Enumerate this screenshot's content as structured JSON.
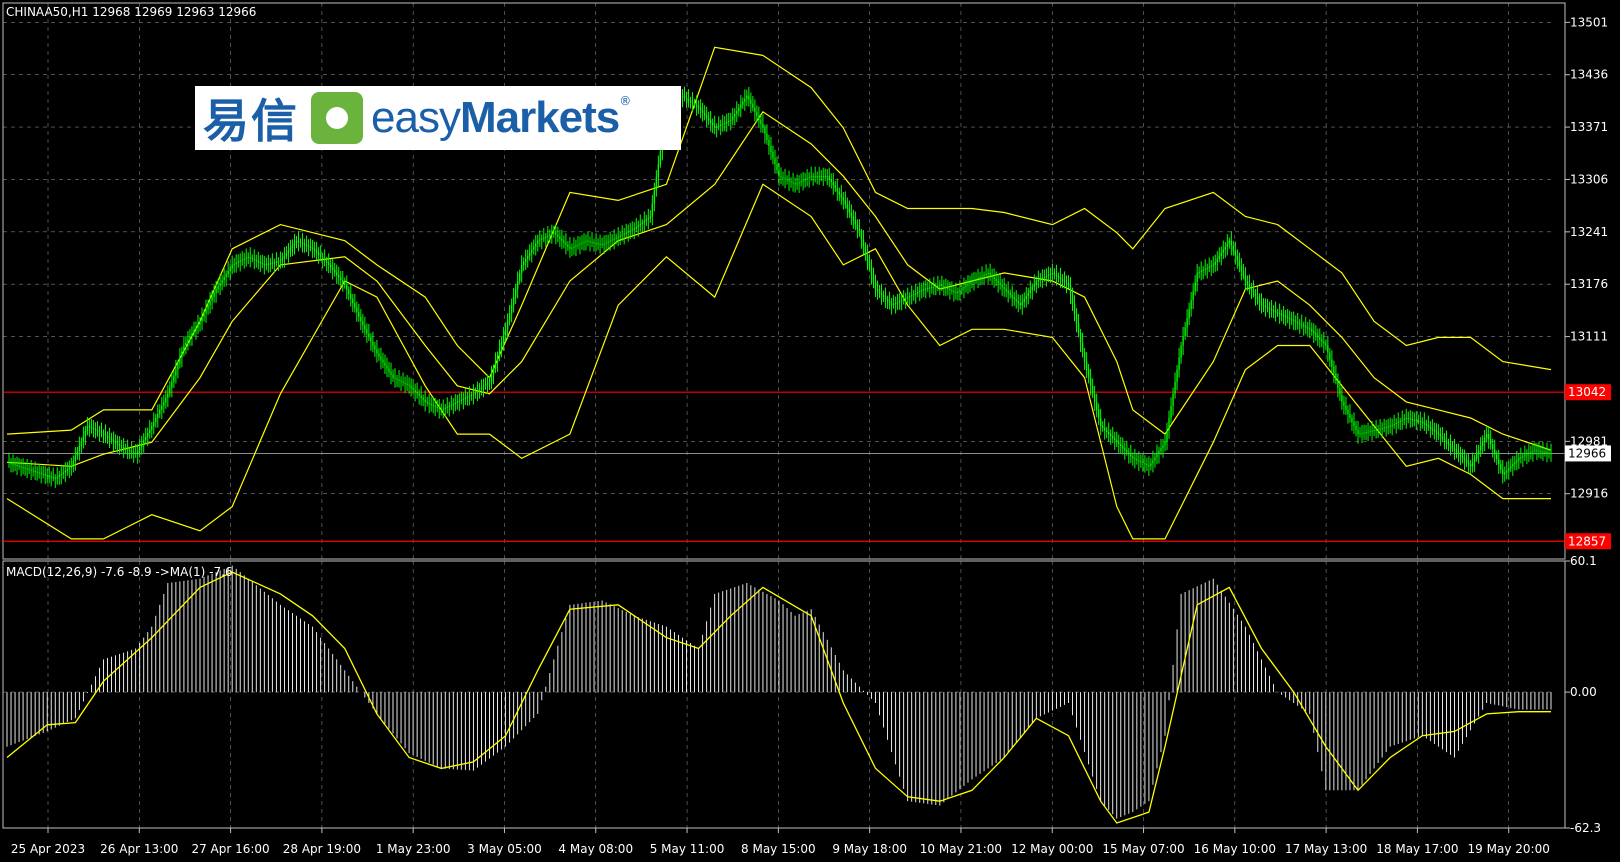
{
  "header": {
    "symbol_info": "CHINAA50,H1  12968 12969 12963 12966",
    "macd_info": "MACD(12,26,9) -7.6 -8.9  ->MA(1) -7.6"
  },
  "logo": {
    "chinese": "易信",
    "brand_light": "easy",
    "brand_bold": "Markets",
    "registered": "®"
  },
  "colors": {
    "background": "#000000",
    "candle": "#00ff00",
    "bands": "#ffff00",
    "level_line": "#ff0000",
    "grid": "#808080",
    "histogram": "#ffffff",
    "signal": "#ffff00"
  },
  "chart_data": [
    {
      "type": "candlestick",
      "symbol": "CHINAA50",
      "timeframe": "H1",
      "last_ohlc": {
        "open": 12968,
        "high": 12969,
        "low": 12963,
        "close": 12966
      },
      "ylim": [
        12835,
        13525
      ],
      "y_ticks": [
        13501,
        13436,
        13371,
        13306,
        13241,
        13176,
        13111,
        12981,
        12916
      ],
      "x_ticks": [
        "25 Apr 2023",
        "26 Apr 13:00",
        "27 Apr 16:00",
        "28 Apr 19:00",
        "1 May 23:00",
        "3 May 05:00",
        "4 May 08:00",
        "5 May 11:00",
        "8 May 15:00",
        "9 May 18:00",
        "10 May 21:00",
        "12 May 00:00",
        "15 May 07:00",
        "16 May 10:00",
        "17 May 13:00",
        "18 May 17:00",
        "19 May 20:00"
      ],
      "horizontal_levels": [
        {
          "value": 13042,
          "label": "13042",
          "color": "#ff0000"
        },
        {
          "value": 12857,
          "label": "12857",
          "color": "#ff0000"
        }
      ],
      "current_price": {
        "value": 12966,
        "label": "12966"
      },
      "close_path": [
        [
          0,
          12955
        ],
        [
          12,
          12945
        ],
        [
          24,
          12935
        ],
        [
          32,
          12950
        ],
        [
          40,
          13000
        ],
        [
          48,
          12990
        ],
        [
          56,
          12975
        ],
        [
          64,
          12965
        ],
        [
          72,
          13000
        ],
        [
          80,
          13040
        ],
        [
          88,
          13100
        ],
        [
          96,
          13130
        ],
        [
          104,
          13170
        ],
        [
          112,
          13200
        ],
        [
          120,
          13210
        ],
        [
          128,
          13200
        ],
        [
          136,
          13205
        ],
        [
          144,
          13230
        ],
        [
          152,
          13220
        ],
        [
          160,
          13200
        ],
        [
          168,
          13175
        ],
        [
          176,
          13130
        ],
        [
          184,
          13090
        ],
        [
          192,
          13060
        ],
        [
          200,
          13050
        ],
        [
          208,
          13030
        ],
        [
          216,
          13020
        ],
        [
          224,
          13030
        ],
        [
          232,
          13040
        ],
        [
          240,
          13055
        ],
        [
          248,
          13120
        ],
        [
          256,
          13200
        ],
        [
          264,
          13230
        ],
        [
          272,
          13240
        ],
        [
          280,
          13220
        ],
        [
          288,
          13230
        ],
        [
          296,
          13225
        ],
        [
          304,
          13235
        ],
        [
          312,
          13245
        ],
        [
          320,
          13260
        ],
        [
          328,
          13390
        ],
        [
          336,
          13410
        ],
        [
          344,
          13395
        ],
        [
          352,
          13370
        ],
        [
          360,
          13380
        ],
        [
          368,
          13410
        ],
        [
          376,
          13370
        ],
        [
          384,
          13310
        ],
        [
          392,
          13300
        ],
        [
          400,
          13310
        ],
        [
          408,
          13310
        ],
        [
          416,
          13280
        ],
        [
          424,
          13240
        ],
        [
          432,
          13170
        ],
        [
          440,
          13150
        ],
        [
          448,
          13160
        ],
        [
          456,
          13170
        ],
        [
          464,
          13175
        ],
        [
          472,
          13165
        ],
        [
          480,
          13180
        ],
        [
          488,
          13190
        ],
        [
          496,
          13170
        ],
        [
          504,
          13150
        ],
        [
          512,
          13180
        ],
        [
          520,
          13190
        ],
        [
          528,
          13175
        ],
        [
          536,
          13080
        ],
        [
          544,
          13000
        ],
        [
          552,
          12980
        ],
        [
          560,
          12960
        ],
        [
          568,
          12950
        ],
        [
          576,
          12980
        ],
        [
          584,
          13100
        ],
        [
          592,
          13190
        ],
        [
          600,
          13200
        ],
        [
          608,
          13230
        ],
        [
          616,
          13180
        ],
        [
          624,
          13150
        ],
        [
          632,
          13140
        ],
        [
          640,
          13130
        ],
        [
          648,
          13120
        ],
        [
          656,
          13100
        ],
        [
          664,
          13030
        ],
        [
          672,
          12990
        ],
        [
          680,
          12995
        ],
        [
          688,
          13000
        ],
        [
          696,
          13010
        ],
        [
          704,
          13005
        ],
        [
          712,
          12990
        ],
        [
          720,
          12970
        ],
        [
          728,
          12950
        ],
        [
          736,
          12990
        ],
        [
          744,
          12940
        ],
        [
          752,
          12960
        ],
        [
          760,
          12970
        ],
        [
          768,
          12966
        ]
      ],
      "bands_upper_path": [
        [
          0,
          12990
        ],
        [
          32,
          12995
        ],
        [
          48,
          13020
        ],
        [
          72,
          13020
        ],
        [
          96,
          13130
        ],
        [
          112,
          13220
        ],
        [
          136,
          13250
        ],
        [
          168,
          13230
        ],
        [
          184,
          13200
        ],
        [
          208,
          13160
        ],
        [
          224,
          13100
        ],
        [
          240,
          13060
        ],
        [
          256,
          13150
        ],
        [
          280,
          13290
        ],
        [
          304,
          13280
        ],
        [
          328,
          13300
        ],
        [
          352,
          13470
        ],
        [
          376,
          13460
        ],
        [
          400,
          13420
        ],
        [
          416,
          13370
        ],
        [
          432,
          13290
        ],
        [
          448,
          13270
        ],
        [
          464,
          13270
        ],
        [
          480,
          13270
        ],
        [
          496,
          13265
        ],
        [
          520,
          13250
        ],
        [
          536,
          13270
        ],
        [
          552,
          13240
        ],
        [
          560,
          13220
        ],
        [
          576,
          13270
        ],
        [
          600,
          13290
        ],
        [
          616,
          13260
        ],
        [
          632,
          13250
        ],
        [
          648,
          13220
        ],
        [
          664,
          13190
        ],
        [
          680,
          13130
        ],
        [
          696,
          13100
        ],
        [
          712,
          13110
        ],
        [
          728,
          13110
        ],
        [
          744,
          13080
        ],
        [
          768,
          13070
        ]
      ],
      "bands_middle_path": [
        [
          0,
          12955
        ],
        [
          32,
          12950
        ],
        [
          48,
          12965
        ],
        [
          72,
          12980
        ],
        [
          96,
          13060
        ],
        [
          112,
          13130
        ],
        [
          136,
          13200
        ],
        [
          168,
          13210
        ],
        [
          184,
          13180
        ],
        [
          208,
          13100
        ],
        [
          224,
          13050
        ],
        [
          240,
          13040
        ],
        [
          256,
          13080
        ],
        [
          280,
          13180
        ],
        [
          304,
          13230
        ],
        [
          328,
          13250
        ],
        [
          352,
          13300
        ],
        [
          376,
          13390
        ],
        [
          400,
          13350
        ],
        [
          416,
          13310
        ],
        [
          432,
          13260
        ],
        [
          448,
          13200
        ],
        [
          464,
          13170
        ],
        [
          480,
          13180
        ],
        [
          496,
          13190
        ],
        [
          520,
          13180
        ],
        [
          536,
          13160
        ],
        [
          552,
          13080
        ],
        [
          560,
          13020
        ],
        [
          576,
          12990
        ],
        [
          600,
          13080
        ],
        [
          616,
          13170
        ],
        [
          632,
          13180
        ],
        [
          648,
          13150
        ],
        [
          664,
          13110
        ],
        [
          680,
          13060
        ],
        [
          696,
          13030
        ],
        [
          712,
          13020
        ],
        [
          728,
          13010
        ],
        [
          744,
          12990
        ],
        [
          768,
          12970
        ]
      ],
      "bands_lower_path": [
        [
          0,
          12910
        ],
        [
          32,
          12860
        ],
        [
          48,
          12860
        ],
        [
          72,
          12890
        ],
        [
          96,
          12870
        ],
        [
          112,
          12900
        ],
        [
          136,
          13040
        ],
        [
          168,
          13180
        ],
        [
          184,
          13160
        ],
        [
          208,
          13050
        ],
        [
          224,
          12990
        ],
        [
          240,
          12990
        ],
        [
          256,
          12960
        ],
        [
          280,
          12990
        ],
        [
          304,
          13150
        ],
        [
          328,
          13210
        ],
        [
          352,
          13160
        ],
        [
          376,
          13300
        ],
        [
          400,
          13260
        ],
        [
          416,
          13200
        ],
        [
          432,
          13220
        ],
        [
          448,
          13150
        ],
        [
          464,
          13100
        ],
        [
          480,
          13120
        ],
        [
          496,
          13120
        ],
        [
          520,
          13110
        ],
        [
          536,
          13060
        ],
        [
          552,
          12900
        ],
        [
          560,
          12860
        ],
        [
          576,
          12860
        ],
        [
          600,
          12980
        ],
        [
          616,
          13070
        ],
        [
          632,
          13100
        ],
        [
          648,
          13100
        ],
        [
          664,
          13050
        ],
        [
          680,
          13000
        ],
        [
          696,
          12950
        ],
        [
          712,
          12960
        ],
        [
          728,
          12940
        ],
        [
          744,
          12910
        ],
        [
          768,
          12910
        ]
      ]
    },
    {
      "type": "histogram",
      "indicator": "MACD(12,26,9)",
      "macd": -7.6,
      "signal": -8.9,
      "ma": -7.6,
      "ylim": [
        -62.3,
        60.1
      ],
      "y_ticks": [
        60.1,
        0.0,
        -62.3
      ],
      "y_tick_labels": [
        "60.1",
        "0.00",
        "-62.3"
      ],
      "histogram_path": [
        [
          0,
          -25
        ],
        [
          20,
          -18
        ],
        [
          34,
          -12
        ],
        [
          48,
          15
        ],
        [
          64,
          20
        ],
        [
          72,
          30
        ],
        [
          80,
          50
        ],
        [
          96,
          52
        ],
        [
          112,
          58
        ],
        [
          120,
          52
        ],
        [
          136,
          40
        ],
        [
          152,
          30
        ],
        [
          168,
          10
        ],
        [
          184,
          -10
        ],
        [
          200,
          -28
        ],
        [
          216,
          -35
        ],
        [
          232,
          -36
        ],
        [
          248,
          -25
        ],
        [
          264,
          -10
        ],
        [
          280,
          40
        ],
        [
          296,
          42
        ],
        [
          312,
          35
        ],
        [
          328,
          30
        ],
        [
          344,
          20
        ],
        [
          352,
          45
        ],
        [
          368,
          50
        ],
        [
          384,
          42
        ],
        [
          392,
          35
        ],
        [
          400,
          38
        ],
        [
          416,
          10
        ],
        [
          432,
          -5
        ],
        [
          448,
          -50
        ],
        [
          464,
          -52
        ],
        [
          480,
          -40
        ],
        [
          496,
          -30
        ],
        [
          512,
          -12
        ],
        [
          528,
          -5
        ],
        [
          544,
          -50
        ],
        [
          552,
          -58
        ],
        [
          560,
          -55
        ],
        [
          568,
          -50
        ],
        [
          576,
          -20
        ],
        [
          584,
          45
        ],
        [
          600,
          52
        ],
        [
          616,
          30
        ],
        [
          632,
          0
        ],
        [
          648,
          -10
        ],
        [
          656,
          -45
        ],
        [
          672,
          -45
        ],
        [
          688,
          -25
        ],
        [
          704,
          -20
        ],
        [
          712,
          -25
        ],
        [
          720,
          -30
        ],
        [
          736,
          -5
        ],
        [
          752,
          -8
        ],
        [
          768,
          -8
        ]
      ],
      "signal_path": [
        [
          0,
          -30
        ],
        [
          20,
          -15
        ],
        [
          34,
          -14
        ],
        [
          48,
          5
        ],
        [
          72,
          25
        ],
        [
          96,
          48
        ],
        [
          112,
          55
        ],
        [
          136,
          45
        ],
        [
          152,
          35
        ],
        [
          168,
          20
        ],
        [
          184,
          -10
        ],
        [
          200,
          -30
        ],
        [
          216,
          -35
        ],
        [
          232,
          -32
        ],
        [
          248,
          -20
        ],
        [
          264,
          10
        ],
        [
          280,
          38
        ],
        [
          304,
          40
        ],
        [
          328,
          25
        ],
        [
          344,
          20
        ],
        [
          360,
          35
        ],
        [
          376,
          48
        ],
        [
          400,
          35
        ],
        [
          416,
          -5
        ],
        [
          432,
          -35
        ],
        [
          448,
          -48
        ],
        [
          464,
          -50
        ],
        [
          480,
          -45
        ],
        [
          496,
          -30
        ],
        [
          512,
          -12
        ],
        [
          528,
          -20
        ],
        [
          544,
          -50
        ],
        [
          552,
          -60
        ],
        [
          568,
          -55
        ],
        [
          576,
          -25
        ],
        [
          592,
          40
        ],
        [
          608,
          48
        ],
        [
          624,
          20
        ],
        [
          640,
          0
        ],
        [
          656,
          -25
        ],
        [
          672,
          -45
        ],
        [
          688,
          -30
        ],
        [
          704,
          -20
        ],
        [
          720,
          -18
        ],
        [
          736,
          -10
        ],
        [
          752,
          -9
        ],
        [
          768,
          -9
        ]
      ]
    }
  ]
}
